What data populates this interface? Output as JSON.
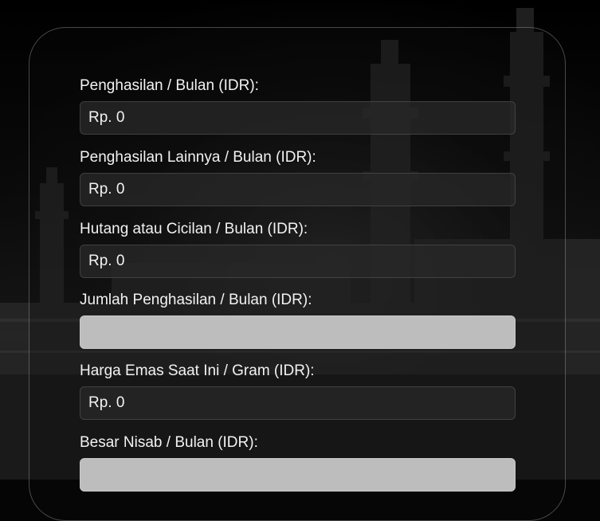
{
  "form": {
    "fields": [
      {
        "label": "Penghasilan / Bulan (IDR):",
        "value": "Rp. 0",
        "readonly": false
      },
      {
        "label": "Penghasilan Lainnya / Bulan (IDR):",
        "value": "Rp. 0",
        "readonly": false
      },
      {
        "label": "Hutang atau Cicilan / Bulan (IDR):",
        "value": "Rp. 0",
        "readonly": false
      },
      {
        "label": "Jumlah Penghasilan / Bulan (IDR):",
        "value": "",
        "readonly": true
      },
      {
        "label": "Harga Emas Saat Ini / Gram (IDR):",
        "value": "Rp. 0",
        "readonly": false
      },
      {
        "label": "Besar Nisab / Bulan (IDR):",
        "value": "",
        "readonly": true
      }
    ]
  }
}
